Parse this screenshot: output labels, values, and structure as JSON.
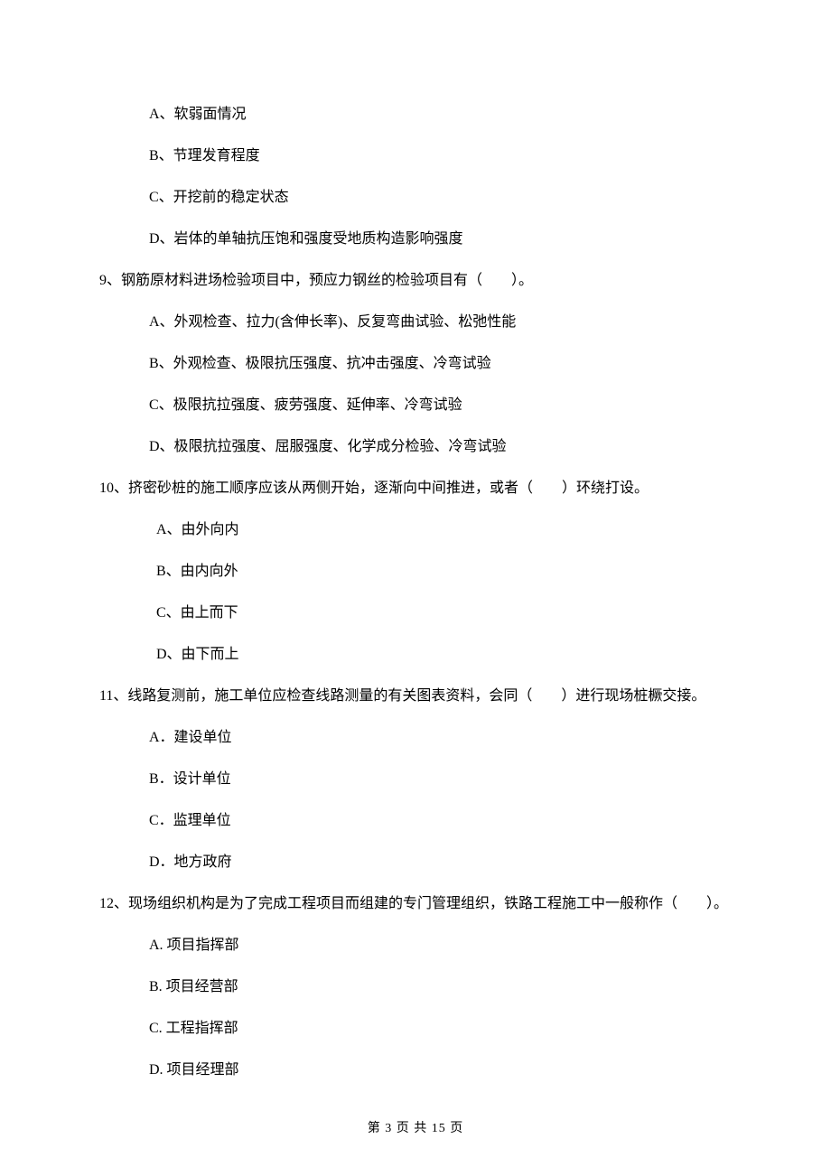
{
  "q8": {
    "A": "A、软弱面情况",
    "B": "B、节理发育程度",
    "C": "C、开挖前的稳定状态",
    "D": "D、岩体的单轴抗压饱和强度受地质构造影响强度"
  },
  "q9": {
    "stem": "9、钢筋原材料进场检验项目中，预应力钢丝的检验项目有（　　）。",
    "A": "A、外观检查、拉力(含伸长率)、反复弯曲试验、松弛性能",
    "B": "B、外观检查、极限抗压强度、抗冲击强度、冷弯试验",
    "C": "C、极限抗拉强度、疲劳强度、延伸率、冷弯试验",
    "D": "D、极限抗拉强度、屈服强度、化学成分检验、冷弯试验"
  },
  "q10": {
    "stem": "10、挤密砂桩的施工顺序应该从两侧开始，逐渐向中间推进，或者（　　）环绕打设。",
    "A": "A、由外向内",
    "B": "B、由内向外",
    "C": "C、由上而下",
    "D": "D、由下而上"
  },
  "q11": {
    "stem": "11、线路复测前，施工单位应检查线路测量的有关图表资料，会同（　　）进行现场桩橛交接。",
    "A": "A．建设单位",
    "B": "B．设计单位",
    "C": "C．监理单位",
    "D": "D．地方政府"
  },
  "q12": {
    "stem": "12、现场组织机构是为了完成工程项目而组建的专门管理组织，铁路工程施工中一般称作（　　）。",
    "A": "A. 项目指挥部",
    "B": "B. 项目经营部",
    "C": "C. 工程指挥部",
    "D": "D. 项目经理部"
  },
  "footer": "第 3 页 共 15 页"
}
